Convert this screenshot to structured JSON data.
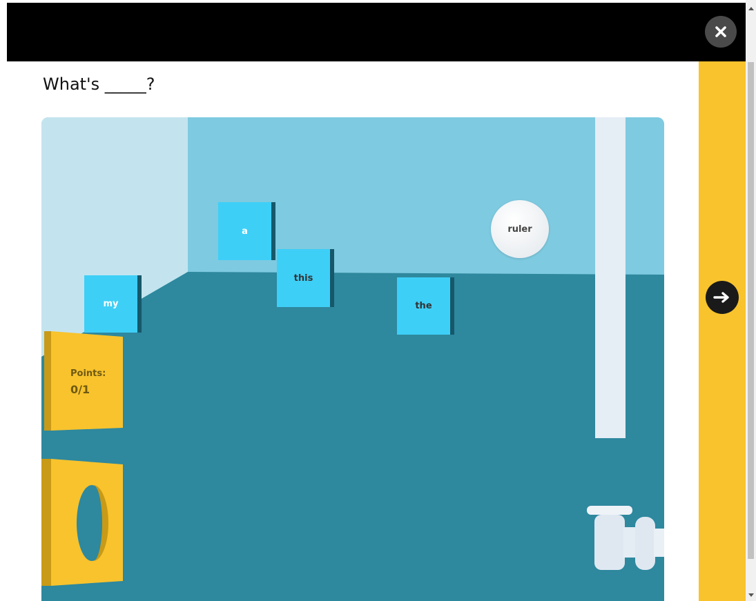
{
  "question": {
    "text": "What's _____?"
  },
  "cards": {
    "a": "a",
    "this": "this",
    "my": "my",
    "the": "the"
  },
  "ball": {
    "label": "ruler"
  },
  "score": {
    "label": "Points:",
    "value": "0/1"
  },
  "icons": {
    "close": "close-icon",
    "next": "arrow-right-icon"
  },
  "colors": {
    "accent": "#f8c32d",
    "card": "#3ecff7",
    "floor": "#2e889e",
    "wall": "#7ecae0"
  }
}
